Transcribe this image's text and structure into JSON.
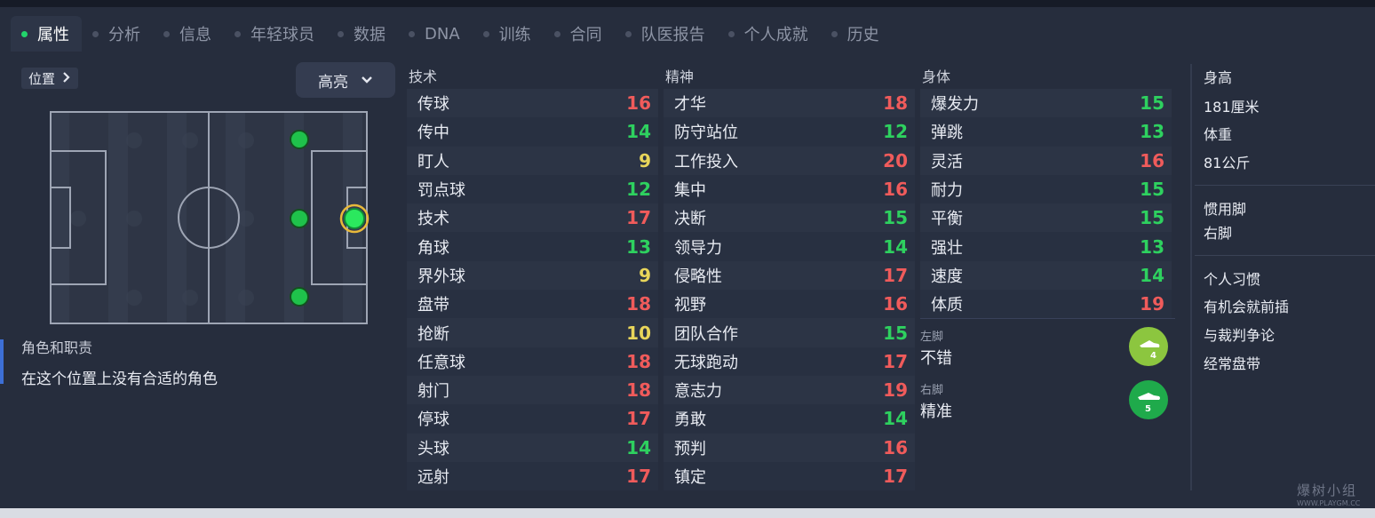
{
  "tabs": [
    {
      "label": "属性",
      "active": true
    },
    {
      "label": "分析"
    },
    {
      "label": "信息"
    },
    {
      "label": "年轻球员"
    },
    {
      "label": "数据"
    },
    {
      "label": "DNA"
    },
    {
      "label": "训练"
    },
    {
      "label": "合同"
    },
    {
      "label": "队医报告"
    },
    {
      "label": "个人成就"
    },
    {
      "label": "历史"
    }
  ],
  "position": {
    "button_label": "位置",
    "highlight_label": "高亮",
    "role_title": "角色和职责",
    "role_text": "在这个位置上没有合适的角色"
  },
  "columns": {
    "technical": {
      "title": "技术",
      "rows": [
        {
          "name": "传球",
          "value": "16",
          "tone": "red"
        },
        {
          "name": "传中",
          "value": "14",
          "tone": "green"
        },
        {
          "name": "盯人",
          "value": "9",
          "tone": "yellow"
        },
        {
          "name": "罚点球",
          "value": "12",
          "tone": "green"
        },
        {
          "name": "技术",
          "value": "17",
          "tone": "red"
        },
        {
          "name": "角球",
          "value": "13",
          "tone": "green"
        },
        {
          "name": "界外球",
          "value": "9",
          "tone": "yellow"
        },
        {
          "name": "盘带",
          "value": "18",
          "tone": "red"
        },
        {
          "name": "抢断",
          "value": "10",
          "tone": "yellow"
        },
        {
          "name": "任意球",
          "value": "18",
          "tone": "red"
        },
        {
          "name": "射门",
          "value": "18",
          "tone": "red"
        },
        {
          "name": "停球",
          "value": "17",
          "tone": "red"
        },
        {
          "name": "头球",
          "value": "14",
          "tone": "green"
        },
        {
          "name": "远射",
          "value": "17",
          "tone": "red"
        }
      ]
    },
    "mental": {
      "title": "精神",
      "rows": [
        {
          "name": "才华",
          "value": "18",
          "tone": "red"
        },
        {
          "name": "防守站位",
          "value": "12",
          "tone": "green"
        },
        {
          "name": "工作投入",
          "value": "20",
          "tone": "red"
        },
        {
          "name": "集中",
          "value": "16",
          "tone": "red"
        },
        {
          "name": "决断",
          "value": "15",
          "tone": "green"
        },
        {
          "name": "领导力",
          "value": "14",
          "tone": "green"
        },
        {
          "name": "侵略性",
          "value": "17",
          "tone": "red"
        },
        {
          "name": "视野",
          "value": "16",
          "tone": "red"
        },
        {
          "name": "团队合作",
          "value": "15",
          "tone": "green"
        },
        {
          "name": "无球跑动",
          "value": "17",
          "tone": "red"
        },
        {
          "name": "意志力",
          "value": "19",
          "tone": "red"
        },
        {
          "name": "勇敢",
          "value": "14",
          "tone": "green"
        },
        {
          "name": "预判",
          "value": "16",
          "tone": "red"
        },
        {
          "name": "镇定",
          "value": "17",
          "tone": "red"
        }
      ]
    },
    "physical": {
      "title": "身体",
      "rows": [
        {
          "name": "爆发力",
          "value": "15",
          "tone": "green"
        },
        {
          "name": "弹跳",
          "value": "13",
          "tone": "green"
        },
        {
          "name": "灵活",
          "value": "16",
          "tone": "red"
        },
        {
          "name": "耐力",
          "value": "15",
          "tone": "green"
        },
        {
          "name": "平衡",
          "value": "15",
          "tone": "green"
        },
        {
          "name": "强壮",
          "value": "13",
          "tone": "green"
        },
        {
          "name": "速度",
          "value": "14",
          "tone": "green"
        },
        {
          "name": "体质",
          "value": "19",
          "tone": "red"
        }
      ]
    }
  },
  "feet": {
    "left": {
      "label": "左脚",
      "value": "不错",
      "rating": "4",
      "color": "#8cc63f"
    },
    "right": {
      "label": "右脚",
      "value": "精准",
      "rating": "5",
      "color": "#1faa4b"
    }
  },
  "info": {
    "height_label": "身高",
    "height_value": "181厘米",
    "weight_label": "体重",
    "weight_value": "81公斤",
    "preferred_foot_label": "惯用脚",
    "preferred_foot_value": "右脚",
    "habits_label": "个人习惯",
    "habits": [
      "有机会就前插",
      "与裁判争论",
      "经常盘带"
    ]
  },
  "watermark": {
    "line1": "爆树小组",
    "line2": "WWW.PLAYGM.CC"
  },
  "colors": {
    "red": "#f05b5b",
    "green": "#2ed15f",
    "yellow": "#e8d55a",
    "accent": "#22d46b"
  }
}
